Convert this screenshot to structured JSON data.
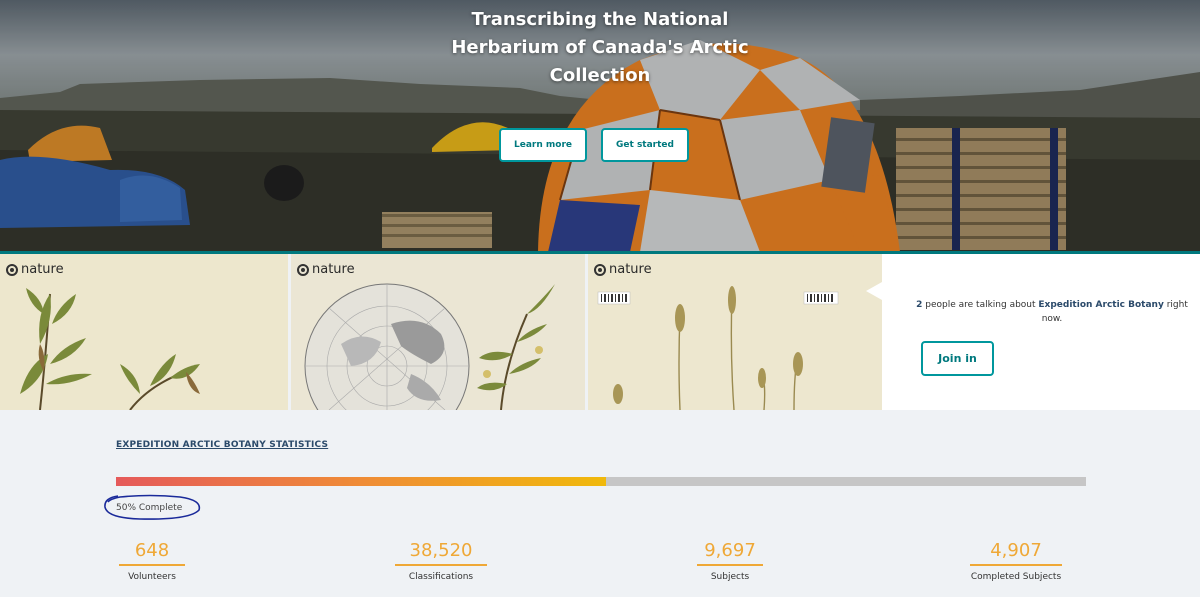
{
  "hero": {
    "title": "Transcribing the National Herbarium of Canada's Arctic Collection",
    "learn_more_label": "Learn more",
    "get_started_label": "Get started"
  },
  "specimens": [
    {
      "logo_text": "nature"
    },
    {
      "logo_text": "nature"
    },
    {
      "logo_text": "nature"
    }
  ],
  "talk": {
    "count": "2",
    "text_before": " people are talking about ",
    "project_name": "Expedition Arctic Botany",
    "text_after": " right now.",
    "join_label": "Join in"
  },
  "stats": {
    "heading": "EXPEDITION ARCTIC BOTANY STATISTICS",
    "progress_fraction": 0.505,
    "complete_label": "50% Complete",
    "items": [
      {
        "value": "648",
        "label": "Volunteers"
      },
      {
        "value": "38,520",
        "label": "Classifications"
      },
      {
        "value": "9,697",
        "label": "Subjects"
      },
      {
        "value": "4,907",
        "label": "Completed Subjects"
      }
    ]
  },
  "colors": {
    "teal": "#00979d",
    "accent_orange": "#efa836",
    "heading_blue": "#2b4a6a",
    "pen_annotation": "#1a2a9a"
  }
}
